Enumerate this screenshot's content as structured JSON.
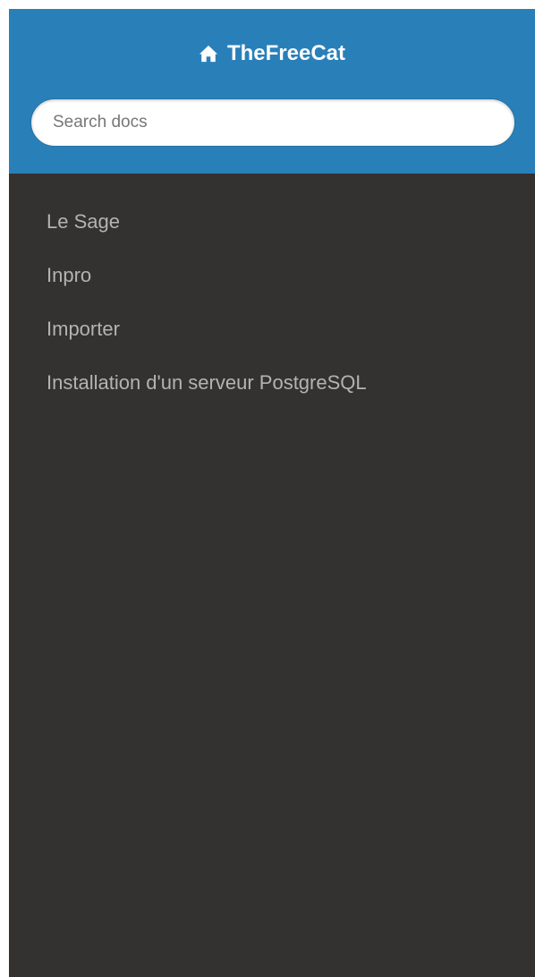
{
  "header": {
    "brand": "TheFreeCat",
    "brand_icon": "home-icon",
    "accent_color": "#2980b9"
  },
  "search": {
    "placeholder": "Search docs",
    "value": ""
  },
  "sidebar": {
    "background_color": "#343131",
    "items": [
      {
        "label": "Le Sage"
      },
      {
        "label": "Inpro"
      },
      {
        "label": "Importer"
      },
      {
        "label": "Installation d'un serveur PostgreSQL"
      }
    ]
  }
}
